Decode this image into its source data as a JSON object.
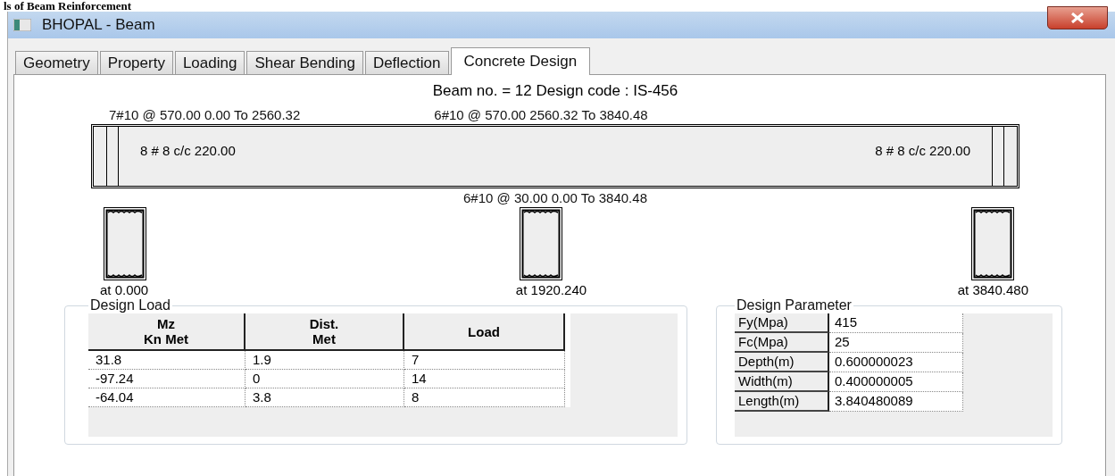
{
  "document_heading": "ls of Beam Reinforcement",
  "window": {
    "title": "BHOPAL - Beam"
  },
  "tabs": [
    {
      "label": "Geometry",
      "selected": false
    },
    {
      "label": "Property",
      "selected": false
    },
    {
      "label": "Loading",
      "selected": false
    },
    {
      "label": "Shear Bending",
      "selected": false
    },
    {
      "label": "Deflection",
      "selected": false
    },
    {
      "label": "Concrete Design",
      "selected": true
    }
  ],
  "design_summary": "Beam no. = 12  Design code :  IS-456",
  "beam_diagram": {
    "top_bars": [
      "7#10 @ 570.00 0.00 To 2560.32",
      "6#10 @ 570.00 2560.32 To 3840.48"
    ],
    "stirrups": [
      "8 # 8 c/c 220.00",
      "8 # 8 c/c 220.00"
    ],
    "bottom_bars": "6#10 @ 30.00 0.00 To 3840.48"
  },
  "sections": [
    {
      "label": "at 0.000"
    },
    {
      "label": "at 1920.240"
    },
    {
      "label": "at 3840.480"
    }
  ],
  "design_load": {
    "title": "Design Load",
    "columns": [
      "Mz\nKn Met",
      "Dist.\nMet",
      "Load"
    ],
    "rows": [
      [
        "31.8",
        "1.9",
        "7"
      ],
      [
        "-97.24",
        "0",
        "14"
      ],
      [
        "-64.04",
        "3.8",
        "8"
      ]
    ]
  },
  "design_parameter": {
    "title": "Design Parameter",
    "rows": [
      {
        "name": "Fy(Mpa)",
        "value": "415"
      },
      {
        "name": "Fc(Mpa)",
        "value": "25"
      },
      {
        "name": "Depth(m)",
        "value": "0.600000023"
      },
      {
        "name": "Width(m)",
        "value": "0.400000005"
      },
      {
        "name": "Length(m)",
        "value": "3.840480089"
      }
    ]
  }
}
